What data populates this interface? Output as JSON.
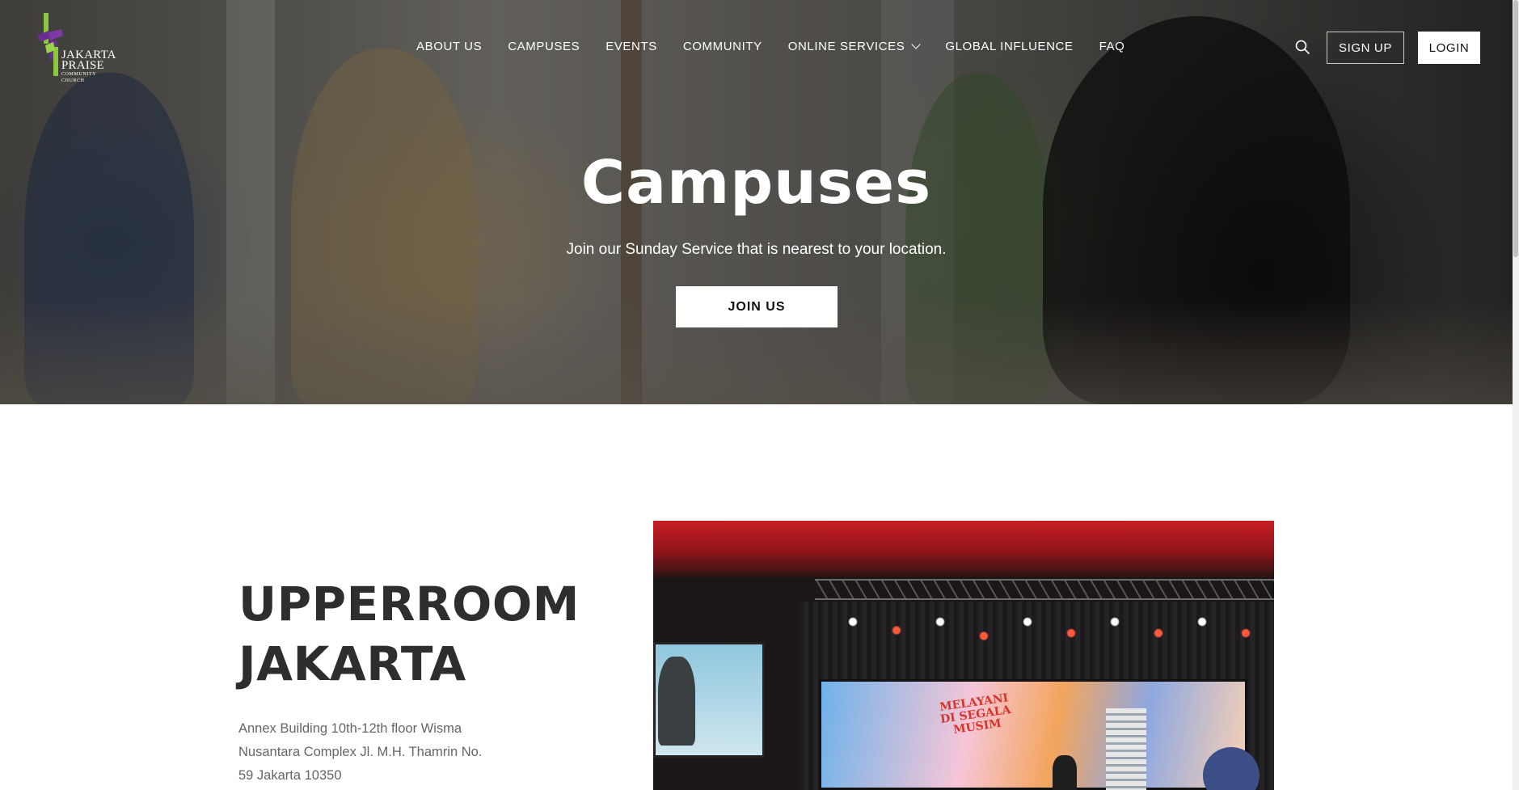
{
  "nav": {
    "logo": {
      "line1": "JAKARTA",
      "line2": "PRAISE",
      "tagline": "COMMUNITY CHURCH"
    },
    "items": [
      {
        "label": "ABOUT US"
      },
      {
        "label": "CAMPUSES"
      },
      {
        "label": "EVENTS"
      },
      {
        "label": "COMMUNITY"
      },
      {
        "label": "ONLINE SERVICES",
        "has_dropdown": true
      },
      {
        "label": "GLOBAL INFLUENCE"
      },
      {
        "label": "FAQ"
      }
    ],
    "search_icon": "search-icon",
    "signup_label": "SIGN UP",
    "login_label": "LOGIN"
  },
  "hero": {
    "title": "Campuses",
    "subtitle": "Join our Sunday Service that is nearest to your location.",
    "cta_label": "JOIN US"
  },
  "campus": {
    "name_line1": "UPPERROOM",
    "name_line2": "JAKARTA",
    "address_lines": [
      "Annex Building 10th-12th floor Wisma",
      "Nusantara Complex Jl. M.H. Thamrin No.",
      "59 Jakarta 10350"
    ],
    "photo": {
      "screen_text_line1": "MELAYANI",
      "screen_text_line2": "DI SEGALA",
      "screen_text_line3": "MUSIM"
    }
  },
  "colors": {
    "logo_purple": "#6a2c91",
    "logo_green": "#8cc63f",
    "button_white": "#ffffff",
    "heading_dark": "#2e2e2e",
    "address_gray": "#666666"
  }
}
